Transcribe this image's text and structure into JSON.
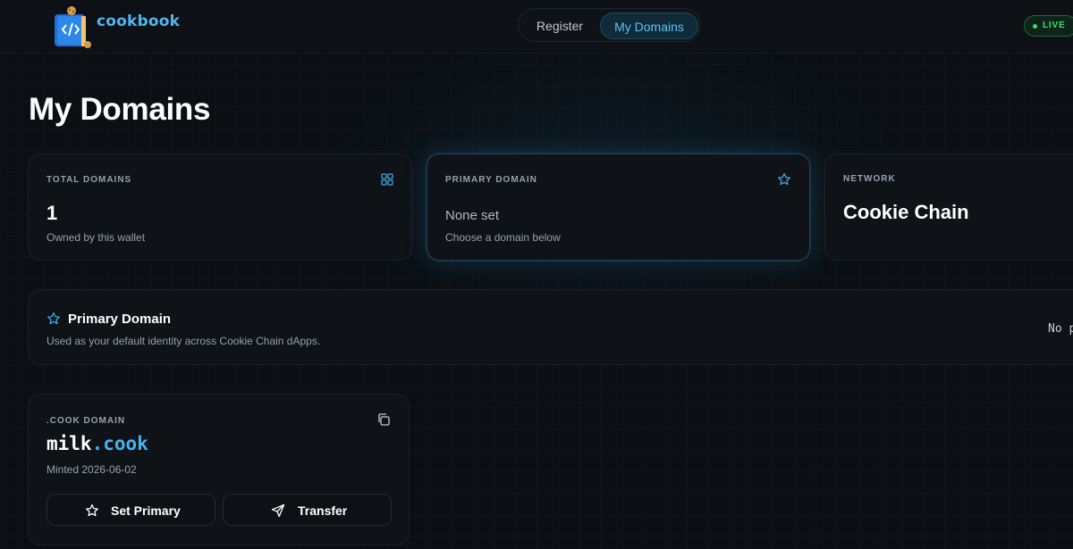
{
  "header": {
    "brand": "cookbook",
    "nav": {
      "register": "Register",
      "my_domains": "My Domains"
    },
    "status": "LIVE",
    "accent": "#4fb6f0",
    "status_color": "#3ddc7a"
  },
  "page": {
    "title": "My Domains"
  },
  "stats": {
    "total": {
      "label": "TOTAL DOMAINS",
      "value": "1",
      "sub": "Owned by this wallet",
      "icon": "grid-icon"
    },
    "primary": {
      "label": "PRIMARY DOMAIN",
      "value": "None set",
      "sub": "Choose a domain below",
      "icon": "star-icon"
    },
    "network": {
      "label": "NETWORK",
      "value": "Cookie Chain"
    }
  },
  "primary_section": {
    "title": "Primary Domain",
    "description": "Used as your default identity across Cookie Chain dApps.",
    "empty_text": "No p",
    "icon": "star-icon"
  },
  "domains": [
    {
      "label": ".COOK DOMAIN",
      "name": "milk",
      "tld": ".cook",
      "minted": "Minted 2026-06-02",
      "set_primary_label": "Set Primary",
      "transfer_label": "Transfer",
      "tld_color": "#47b3ee"
    }
  ]
}
